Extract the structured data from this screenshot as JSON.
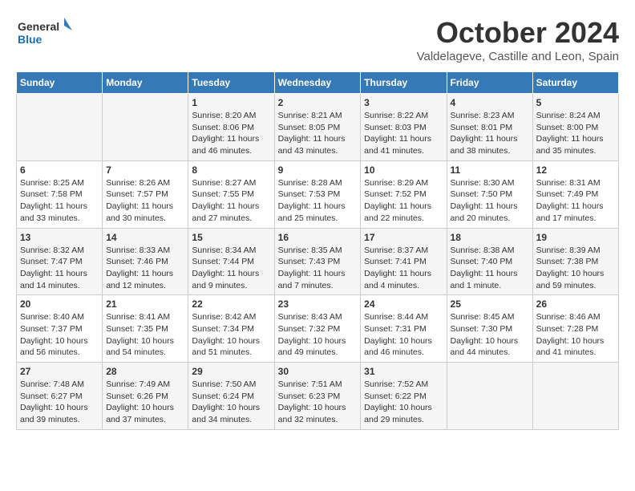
{
  "logo": {
    "line1": "General",
    "line2": "Blue"
  },
  "title": "October 2024",
  "subtitle": "Valdelageve, Castille and Leon, Spain",
  "days_of_week": [
    "Sunday",
    "Monday",
    "Tuesday",
    "Wednesday",
    "Thursday",
    "Friday",
    "Saturday"
  ],
  "weeks": [
    [
      {
        "day": "",
        "detail": ""
      },
      {
        "day": "",
        "detail": ""
      },
      {
        "day": "1",
        "detail": "Sunrise: 8:20 AM\nSunset: 8:06 PM\nDaylight: 11 hours and 46 minutes."
      },
      {
        "day": "2",
        "detail": "Sunrise: 8:21 AM\nSunset: 8:05 PM\nDaylight: 11 hours and 43 minutes."
      },
      {
        "day": "3",
        "detail": "Sunrise: 8:22 AM\nSunset: 8:03 PM\nDaylight: 11 hours and 41 minutes."
      },
      {
        "day": "4",
        "detail": "Sunrise: 8:23 AM\nSunset: 8:01 PM\nDaylight: 11 hours and 38 minutes."
      },
      {
        "day": "5",
        "detail": "Sunrise: 8:24 AM\nSunset: 8:00 PM\nDaylight: 11 hours and 35 minutes."
      }
    ],
    [
      {
        "day": "6",
        "detail": "Sunrise: 8:25 AM\nSunset: 7:58 PM\nDaylight: 11 hours and 33 minutes."
      },
      {
        "day": "7",
        "detail": "Sunrise: 8:26 AM\nSunset: 7:57 PM\nDaylight: 11 hours and 30 minutes."
      },
      {
        "day": "8",
        "detail": "Sunrise: 8:27 AM\nSunset: 7:55 PM\nDaylight: 11 hours and 27 minutes."
      },
      {
        "day": "9",
        "detail": "Sunrise: 8:28 AM\nSunset: 7:53 PM\nDaylight: 11 hours and 25 minutes."
      },
      {
        "day": "10",
        "detail": "Sunrise: 8:29 AM\nSunset: 7:52 PM\nDaylight: 11 hours and 22 minutes."
      },
      {
        "day": "11",
        "detail": "Sunrise: 8:30 AM\nSunset: 7:50 PM\nDaylight: 11 hours and 20 minutes."
      },
      {
        "day": "12",
        "detail": "Sunrise: 8:31 AM\nSunset: 7:49 PM\nDaylight: 11 hours and 17 minutes."
      }
    ],
    [
      {
        "day": "13",
        "detail": "Sunrise: 8:32 AM\nSunset: 7:47 PM\nDaylight: 11 hours and 14 minutes."
      },
      {
        "day": "14",
        "detail": "Sunrise: 8:33 AM\nSunset: 7:46 PM\nDaylight: 11 hours and 12 minutes."
      },
      {
        "day": "15",
        "detail": "Sunrise: 8:34 AM\nSunset: 7:44 PM\nDaylight: 11 hours and 9 minutes."
      },
      {
        "day": "16",
        "detail": "Sunrise: 8:35 AM\nSunset: 7:43 PM\nDaylight: 11 hours and 7 minutes."
      },
      {
        "day": "17",
        "detail": "Sunrise: 8:37 AM\nSunset: 7:41 PM\nDaylight: 11 hours and 4 minutes."
      },
      {
        "day": "18",
        "detail": "Sunrise: 8:38 AM\nSunset: 7:40 PM\nDaylight: 11 hours and 1 minute."
      },
      {
        "day": "19",
        "detail": "Sunrise: 8:39 AM\nSunset: 7:38 PM\nDaylight: 10 hours and 59 minutes."
      }
    ],
    [
      {
        "day": "20",
        "detail": "Sunrise: 8:40 AM\nSunset: 7:37 PM\nDaylight: 10 hours and 56 minutes."
      },
      {
        "day": "21",
        "detail": "Sunrise: 8:41 AM\nSunset: 7:35 PM\nDaylight: 10 hours and 54 minutes."
      },
      {
        "day": "22",
        "detail": "Sunrise: 8:42 AM\nSunset: 7:34 PM\nDaylight: 10 hours and 51 minutes."
      },
      {
        "day": "23",
        "detail": "Sunrise: 8:43 AM\nSunset: 7:32 PM\nDaylight: 10 hours and 49 minutes."
      },
      {
        "day": "24",
        "detail": "Sunrise: 8:44 AM\nSunset: 7:31 PM\nDaylight: 10 hours and 46 minutes."
      },
      {
        "day": "25",
        "detail": "Sunrise: 8:45 AM\nSunset: 7:30 PM\nDaylight: 10 hours and 44 minutes."
      },
      {
        "day": "26",
        "detail": "Sunrise: 8:46 AM\nSunset: 7:28 PM\nDaylight: 10 hours and 41 minutes."
      }
    ],
    [
      {
        "day": "27",
        "detail": "Sunrise: 7:48 AM\nSunset: 6:27 PM\nDaylight: 10 hours and 39 minutes."
      },
      {
        "day": "28",
        "detail": "Sunrise: 7:49 AM\nSunset: 6:26 PM\nDaylight: 10 hours and 37 minutes."
      },
      {
        "day": "29",
        "detail": "Sunrise: 7:50 AM\nSunset: 6:24 PM\nDaylight: 10 hours and 34 minutes."
      },
      {
        "day": "30",
        "detail": "Sunrise: 7:51 AM\nSunset: 6:23 PM\nDaylight: 10 hours and 32 minutes."
      },
      {
        "day": "31",
        "detail": "Sunrise: 7:52 AM\nSunset: 6:22 PM\nDaylight: 10 hours and 29 minutes."
      },
      {
        "day": "",
        "detail": ""
      },
      {
        "day": "",
        "detail": ""
      }
    ]
  ]
}
